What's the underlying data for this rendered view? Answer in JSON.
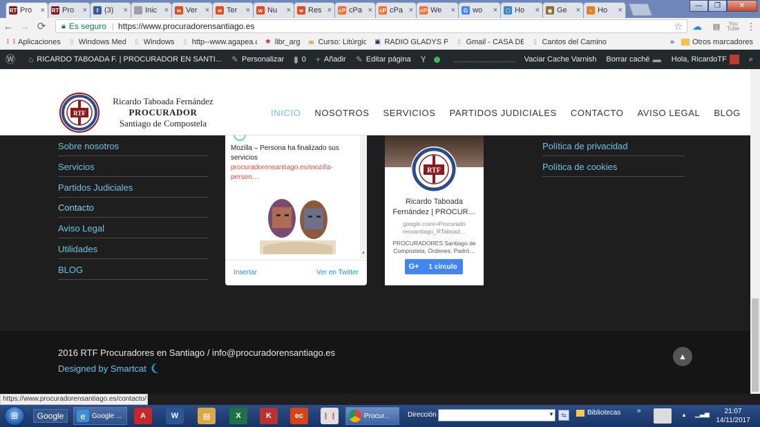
{
  "browser": {
    "tabs": [
      {
        "label": "Pro",
        "icon": "rtf-favicon",
        "color": "#7d1c1c",
        "glyph": "RT"
      },
      {
        "label": "Pro",
        "icon": "rtf-favicon",
        "color": "#7d1c1c",
        "glyph": "RT"
      },
      {
        "label": "(3)",
        "icon": "facebook-favicon",
        "color": "#3b5998",
        "glyph": "f"
      },
      {
        "label": "Inic",
        "icon": "page-favicon",
        "color": "#9aa0a6",
        "glyph": ""
      },
      {
        "label": "Ver",
        "icon": "wix-favicon",
        "color": "#e64a19",
        "glyph": "w"
      },
      {
        "label": "Ter",
        "icon": "wix-favicon",
        "color": "#e64a19",
        "glyph": "w"
      },
      {
        "label": "Nu",
        "icon": "wix-favicon",
        "color": "#e64a19",
        "glyph": "w"
      },
      {
        "label": "Res",
        "icon": "wix-favicon",
        "color": "#e64a19",
        "glyph": "w"
      },
      {
        "label": "cPa",
        "icon": "cpanel-favicon",
        "color": "#ff6c2c",
        "glyph": "cP"
      },
      {
        "label": "cPa",
        "icon": "cpanel-favicon",
        "color": "#ff6c2c",
        "glyph": "cP"
      },
      {
        "label": "We",
        "icon": "cpanel-favicon",
        "color": "#ff6c2c",
        "glyph": "cP"
      },
      {
        "label": "wo",
        "icon": "google-favicon",
        "color": "#4285f4",
        "glyph": "G"
      },
      {
        "label": "Ho",
        "icon": "hexagon-favicon",
        "color": "#3d85c6",
        "glyph": "⬡"
      },
      {
        "label": "Ge",
        "icon": "owl-favicon",
        "color": "#8d6e2b",
        "glyph": "◉"
      },
      {
        "label": "Ho",
        "icon": "orange-favicon",
        "color": "#e67e22",
        "glyph": "▪"
      }
    ],
    "close_glyph": "×",
    "window_buttons": {
      "minimize": "—",
      "maximize": "❐",
      "close": "✕"
    },
    "address": {
      "secure_label": "Es seguro",
      "url": "https://www.procuradorensantiago.es",
      "star": "☆"
    },
    "bookmarks": [
      {
        "label": "Aplicaciones",
        "icon": "apps-icon",
        "color": "#e8453c",
        "glyph": "⋮⋮"
      },
      {
        "label": "Windows Media",
        "icon": "page-icon",
        "color": "#9aa0a6",
        "glyph": "▯"
      },
      {
        "label": "Windows",
        "icon": "page-icon",
        "color": "#9aa0a6",
        "glyph": "▯"
      },
      {
        "label": "http--www.agapea.cc",
        "icon": "page-icon",
        "color": "#9aa0a6",
        "glyph": "▯"
      },
      {
        "label": "libr_arg",
        "icon": "compass-icon",
        "color": "#d93025",
        "glyph": "✱"
      },
      {
        "label": "Curso: Litúrgics",
        "icon": "moodle-icon",
        "color": "#f98012",
        "glyph": "m"
      },
      {
        "label": "RADIO GLADYS PALM",
        "icon": "radio-icon",
        "color": "#1a237e",
        "glyph": "▣"
      },
      {
        "label": "Gmail - CASA DE MA",
        "icon": "page-icon",
        "color": "#9aa0a6",
        "glyph": "▯"
      },
      {
        "label": "Cantos del Camino N",
        "icon": "page-icon",
        "color": "#9aa0a6",
        "glyph": "▯"
      }
    ],
    "bookmarks_overflow": "»",
    "other_bookmarks": "Otros marcadores"
  },
  "wp_admin": {
    "site": "RICARDO TABOADA F. | PROCURADOR EN SANTI...",
    "customize": "Personalizar",
    "comments": "0",
    "add": "Añadir",
    "edit": "Editar página",
    "varnish": "Vaciar Cache Varnish",
    "clear_cache": "Borrar caché",
    "greeting": "Hola, RicardoTF"
  },
  "site": {
    "brand_name": "Ricardo Taboada Fernández",
    "brand_role": "PROCURADOR",
    "brand_city": "Santiago de Compostela",
    "nav": [
      {
        "label": "INICIO",
        "active": true
      },
      {
        "label": "NOSOTROS",
        "active": false
      },
      {
        "label": "SERVICIOS",
        "active": false
      },
      {
        "label": "PARTIDOS JUDICIALES",
        "active": false
      },
      {
        "label": "CONTACTO",
        "active": false
      },
      {
        "label": "AVISO LEGAL",
        "active": false
      },
      {
        "label": "BLOG",
        "active": false
      }
    ],
    "footer_links_left": [
      "Sobre nosotros",
      "Servicios",
      "Partidos Judiciales",
      "Contacto",
      "Aviso Legal",
      "Utilidades",
      "BLOG"
    ],
    "footer_links_right": [
      "Política de privacidad",
      "Política de cookies"
    ],
    "twitter": {
      "text": "Mozilla – Persona ha finalizado sus servicios",
      "link": "procuradorensantiago.es/mozilla-person…",
      "embed": "Insertar",
      "view": "Ver en Twitter"
    },
    "gplus": {
      "name": "Ricardo Taboada Fernández | PROCUR…",
      "url": "google.com/+Procurado rensantiago_RTaboad…",
      "desc": "PROCURADORES Santiago de Compostela, Órdenes, Padró…",
      "button_icon": "G+",
      "button_label": "1 círculo"
    },
    "copyright": "2016 RTF Procuradores en Santiago / info@procuradorensantiago.es",
    "designed_by": "Designed by Smartcat",
    "to_top": "▲"
  },
  "status_url": "https://www.procuradorensantiago.es/contacto/",
  "taskbar": {
    "google_label": "Google",
    "ie_task": "Google ...",
    "chrome_task": "Procur...",
    "direccion_label": "Dirección",
    "bibliotecas": "Bibliotecas",
    "time": "21:07",
    "date": "14/11/2017"
  },
  "colors": {
    "accent": "#6cc4e6",
    "nav_active": "#6ec1e4",
    "footer_bg": "#1e1e1e",
    "wp_bar": "#23282d",
    "gplus": "#4285f4",
    "seal_red": "#8b1a1a"
  }
}
